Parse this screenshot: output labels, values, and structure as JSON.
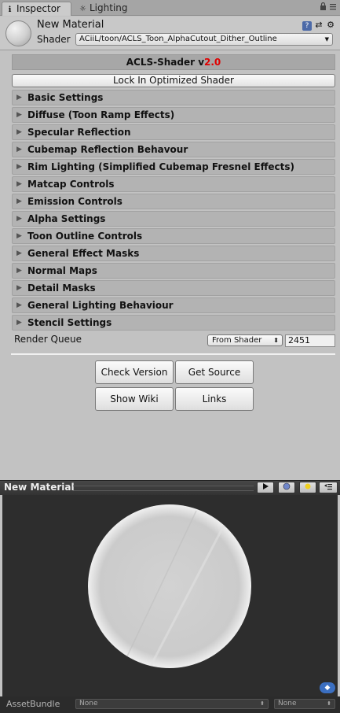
{
  "tabs": {
    "inspector": {
      "icon": "ℹ",
      "label": "Inspector"
    },
    "lighting": {
      "icon": "☼",
      "label": "Lighting"
    }
  },
  "header": {
    "title": "New Material",
    "shader_label": "Shader",
    "shader_value": "ACiiL/toon/ACLS_Toon_AlphaCutout_Dither_Outline"
  },
  "shader_panel": {
    "title": "ACLS-Shader v",
    "version": "2.0",
    "lock_button": "Lock In Optimized Shader"
  },
  "sections": [
    "Basic Settings",
    "Diffuse (Toon Ramp Effects)",
    "Specular Reflection",
    "Cubemap Reflection Behavour",
    "Rim Lighting (Simplified Cubemap Fresnel Effects)",
    "Matcap Controls",
    "Emission Controls",
    "Alpha Settings",
    "Toon Outline Controls",
    "General Effect Masks",
    "Normal Maps",
    "Detail Masks",
    "General Lighting Behaviour",
    "Stencil Settings"
  ],
  "render_queue": {
    "label": "Render Queue",
    "mode": "From Shader",
    "value": "2451"
  },
  "buttons": {
    "check_version": "Check Version",
    "get_source": "Get Source",
    "show_wiki": "Show Wiki",
    "links": "Links"
  },
  "preview": {
    "title": "New Material"
  },
  "asset_bundle": {
    "label": "AssetBundle",
    "name": "None",
    "variant": "None"
  }
}
